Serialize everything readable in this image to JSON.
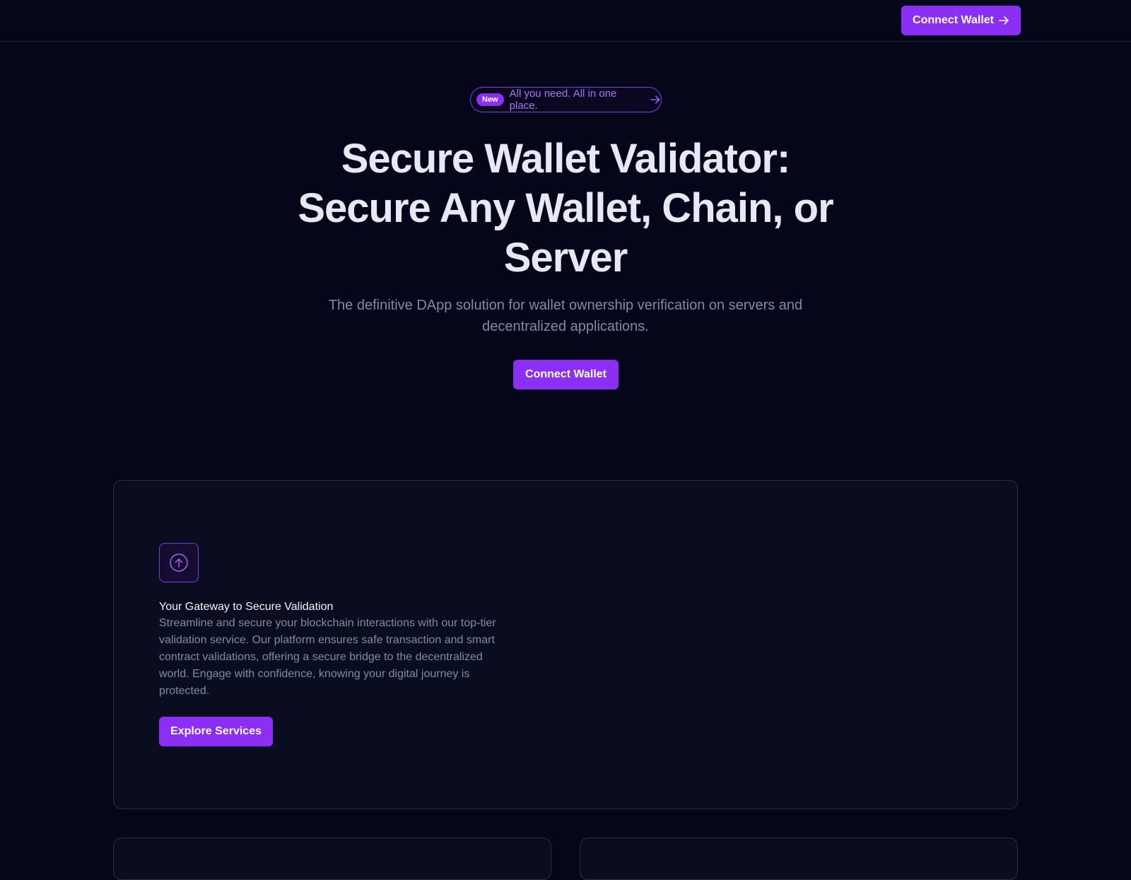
{
  "header": {
    "connect_label": "Connect Wallet",
    "arrow_icon": "arrow-right-icon"
  },
  "announcement": {
    "badge": "New",
    "text": "All you need. All in one place.",
    "arrow_icon": "arrow-right-icon"
  },
  "hero": {
    "title": "Secure Wallet Validator: Secure Any Wallet, Chain, or Server",
    "subtitle": "The definitive DApp solution for wallet ownership verification on servers and decentralized applications.",
    "cta_label": "Connect Wallet"
  },
  "feature": {
    "icon": "arrow-up-circle-icon",
    "title": "Your Gateway to Secure Validation",
    "text": "Streamline and secure your blockchain interactions with our top-tier validation service. Our platform ensures safe transaction and smart contract validations, offering a secure bridge to the decentralized world. Engage with confidence, knowing your digital journey is protected.",
    "cta_label": "Explore Services"
  },
  "colors": {
    "background": "#05061a",
    "accent": "#8b2ff5",
    "card": "#0a0d20",
    "border": "#2a3042",
    "muted_text": "#7f8ba4"
  }
}
